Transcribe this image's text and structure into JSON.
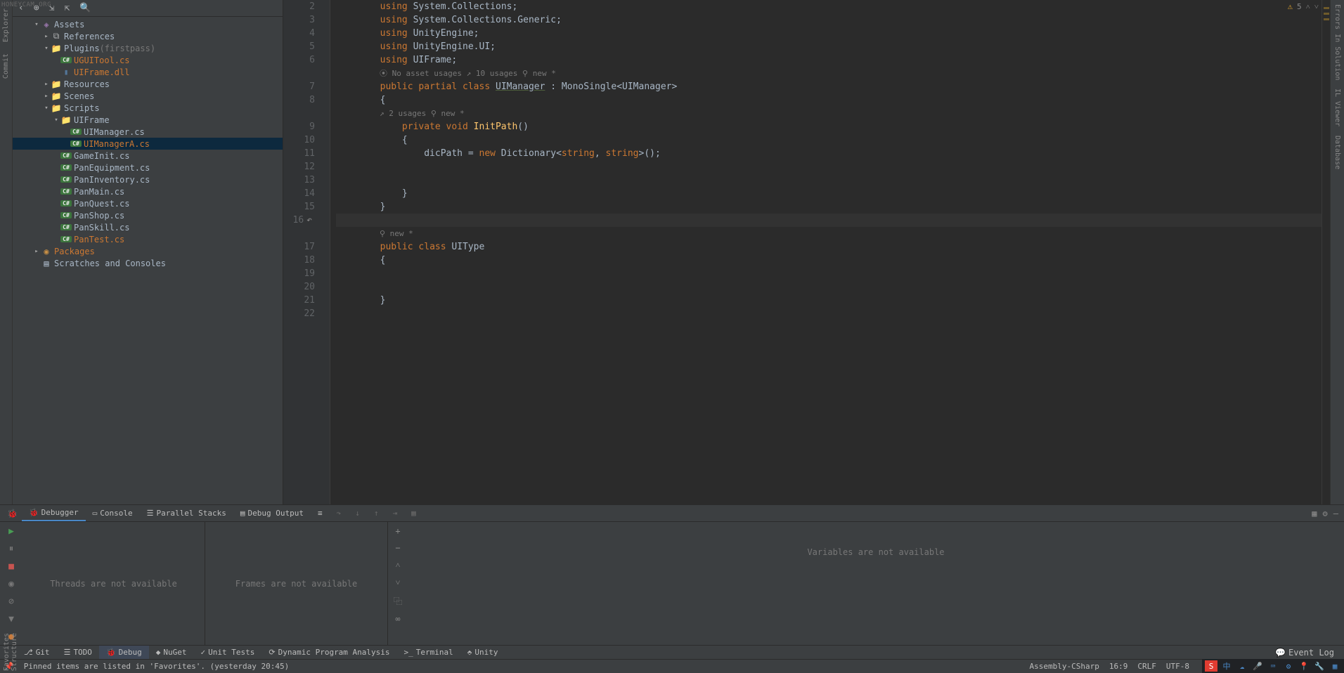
{
  "watermark": "HONEYCAM.ORG",
  "leftRail": {
    "explorer": "Explorer",
    "commit": "Commit"
  },
  "rightRail": {
    "errors": "Errors In Solution",
    "viewer": "IL Viewer",
    "database": "Database"
  },
  "explorer": {
    "tree": [
      {
        "indent": 2,
        "arrow": "▾",
        "icon": "assets",
        "label": "Assets",
        "highlighted": false
      },
      {
        "indent": 3,
        "arrow": "▸",
        "icon": "lib",
        "label": "References",
        "highlighted": false
      },
      {
        "indent": 3,
        "arrow": "▾",
        "icon": "folder",
        "label": "Plugins",
        "suffix": "(firstpass)",
        "highlighted": false
      },
      {
        "indent": 4,
        "arrow": "",
        "icon": "cs",
        "label": "UGUITool.cs",
        "highlighted": true
      },
      {
        "indent": 4,
        "arrow": "",
        "icon": "dll",
        "label": "UIFrame.dll",
        "highlighted": true
      },
      {
        "indent": 3,
        "arrow": "▸",
        "icon": "folder",
        "label": "Resources",
        "highlighted": false
      },
      {
        "indent": 3,
        "arrow": "▸",
        "icon": "folder",
        "label": "Scenes",
        "highlighted": false
      },
      {
        "indent": 3,
        "arrow": "▾",
        "icon": "folder",
        "label": "Scripts",
        "highlighted": false
      },
      {
        "indent": 4,
        "arrow": "▾",
        "icon": "folder",
        "label": "UIFrame",
        "highlighted": false
      },
      {
        "indent": 5,
        "arrow": "",
        "icon": "cs",
        "label": "UIManager.cs",
        "highlighted": false
      },
      {
        "indent": 5,
        "arrow": "",
        "icon": "cs",
        "label": "UIManagerA.cs",
        "highlighted": true,
        "selected": true
      },
      {
        "indent": 4,
        "arrow": "",
        "icon": "cs",
        "label": "GameInit.cs",
        "highlighted": false
      },
      {
        "indent": 4,
        "arrow": "",
        "icon": "cs",
        "label": "PanEquipment.cs",
        "highlighted": false
      },
      {
        "indent": 4,
        "arrow": "",
        "icon": "cs",
        "label": "PanInventory.cs",
        "highlighted": false
      },
      {
        "indent": 4,
        "arrow": "",
        "icon": "cs",
        "label": "PanMain.cs",
        "highlighted": false
      },
      {
        "indent": 4,
        "arrow": "",
        "icon": "cs",
        "label": "PanQuest.cs",
        "highlighted": false
      },
      {
        "indent": 4,
        "arrow": "",
        "icon": "cs",
        "label": "PanShop.cs",
        "highlighted": false
      },
      {
        "indent": 4,
        "arrow": "",
        "icon": "cs",
        "label": "PanSkill.cs",
        "highlighted": false
      },
      {
        "indent": 4,
        "arrow": "",
        "icon": "cs",
        "label": "PanTest.cs",
        "highlighted": true
      },
      {
        "indent": 2,
        "arrow": "▸",
        "icon": "packages",
        "label": "Packages",
        "highlighted": true
      },
      {
        "indent": 2,
        "arrow": "",
        "icon": "scratch",
        "label": "Scratches and Consoles",
        "highlighted": false
      }
    ]
  },
  "editor": {
    "warningCount": "5",
    "lines": [
      {
        "num": "2",
        "type": "code",
        "tokens": [
          {
            "t": "plain",
            "v": "        "
          },
          {
            "t": "kw",
            "v": "using"
          },
          {
            "t": "plain",
            "v": " System.Collections;"
          }
        ]
      },
      {
        "num": "3",
        "type": "code",
        "tokens": [
          {
            "t": "plain",
            "v": "        "
          },
          {
            "t": "kw",
            "v": "using"
          },
          {
            "t": "plain",
            "v": " System.Collections.Generic;"
          }
        ]
      },
      {
        "num": "4",
        "type": "code",
        "tokens": [
          {
            "t": "plain",
            "v": "        "
          },
          {
            "t": "kw",
            "v": "using"
          },
          {
            "t": "plain",
            "v": " UnityEngine;"
          }
        ]
      },
      {
        "num": "5",
        "type": "code",
        "tokens": [
          {
            "t": "plain",
            "v": "        "
          },
          {
            "t": "kw",
            "v": "using"
          },
          {
            "t": "plain",
            "v": " UnityEngine.UI;"
          }
        ]
      },
      {
        "num": "6",
        "type": "code",
        "tokens": [
          {
            "t": "plain",
            "v": "        "
          },
          {
            "t": "kw",
            "v": "using"
          },
          {
            "t": "plain",
            "v": " UIFrame;"
          }
        ]
      },
      {
        "num": "",
        "type": "hint",
        "text": "⦿ No asset usages   ↗ 10 usages   ⚲ new *"
      },
      {
        "num": "7",
        "type": "code",
        "tokens": [
          {
            "t": "plain",
            "v": "        "
          },
          {
            "t": "kw",
            "v": "public partial class"
          },
          {
            "t": "plain",
            "v": " "
          },
          {
            "t": "idu",
            "v": "UIManager"
          },
          {
            "t": "plain",
            "v": " : MonoSingle<UIManager>"
          }
        ]
      },
      {
        "num": "8",
        "type": "code",
        "tokens": [
          {
            "t": "plain",
            "v": "        {"
          }
        ]
      },
      {
        "num": "",
        "type": "hint",
        "text": "    ↗ 2 usages   ⚲ new *"
      },
      {
        "num": "9",
        "type": "code",
        "tokens": [
          {
            "t": "plain",
            "v": "            "
          },
          {
            "t": "kw",
            "v": "private void"
          },
          {
            "t": "plain",
            "v": " "
          },
          {
            "t": "method",
            "v": "InitPath"
          },
          {
            "t": "plain",
            "v": "()"
          }
        ]
      },
      {
        "num": "10",
        "type": "code",
        "tokens": [
          {
            "t": "plain",
            "v": "            {"
          }
        ]
      },
      {
        "num": "11",
        "type": "code",
        "tokens": [
          {
            "t": "plain",
            "v": "                dicPath = "
          },
          {
            "t": "kw",
            "v": "new"
          },
          {
            "t": "plain",
            "v": " Dictionary<"
          },
          {
            "t": "kw",
            "v": "string"
          },
          {
            "t": "plain",
            "v": ", "
          },
          {
            "t": "kw",
            "v": "string"
          },
          {
            "t": "plain",
            "v": ">();"
          }
        ]
      },
      {
        "num": "12",
        "type": "code",
        "tokens": [
          {
            "t": "plain",
            "v": " "
          }
        ]
      },
      {
        "num": "13",
        "type": "code",
        "tokens": [
          {
            "t": "plain",
            "v": " "
          }
        ]
      },
      {
        "num": "14",
        "type": "code",
        "tokens": [
          {
            "t": "plain",
            "v": "            }"
          }
        ]
      },
      {
        "num": "15",
        "type": "code",
        "tokens": [
          {
            "t": "plain",
            "v": "        }"
          }
        ]
      },
      {
        "num": "16",
        "type": "code",
        "cursor": true,
        "undo": true,
        "tokens": [
          {
            "t": "plain",
            "v": " "
          }
        ]
      },
      {
        "num": "",
        "type": "hint",
        "text": "⚲ new *"
      },
      {
        "num": "17",
        "type": "code",
        "tokens": [
          {
            "t": "plain",
            "v": "        "
          },
          {
            "t": "kw",
            "v": "public class"
          },
          {
            "t": "plain",
            "v": " UIType"
          }
        ]
      },
      {
        "num": "18",
        "type": "code",
        "tokens": [
          {
            "t": "plain",
            "v": "        {"
          }
        ]
      },
      {
        "num": "19",
        "type": "code",
        "tokens": [
          {
            "t": "plain",
            "v": " "
          }
        ]
      },
      {
        "num": "20",
        "type": "code",
        "tokens": [
          {
            "t": "plain",
            "v": " "
          }
        ]
      },
      {
        "num": "21",
        "type": "code",
        "tokens": [
          {
            "t": "plain",
            "v": "        }"
          }
        ]
      },
      {
        "num": "22",
        "type": "code",
        "tokens": [
          {
            "t": "plain",
            "v": " "
          }
        ]
      }
    ]
  },
  "debugPanel": {
    "tabs": [
      {
        "icon": "🐞",
        "label": "Debugger",
        "active": true
      },
      {
        "icon": "▭",
        "label": "Console"
      },
      {
        "icon": "☰",
        "label": "Parallel Stacks"
      },
      {
        "icon": "▤",
        "label": "Debug Output"
      }
    ],
    "threadsMsg": "Threads are not available",
    "framesMsg": "Frames are not available",
    "varsMsg": "Variables are not available"
  },
  "bottomTools": [
    {
      "icon": "⎇",
      "label": "Git"
    },
    {
      "icon": "☰",
      "label": "TODO"
    },
    {
      "icon": "🐞",
      "label": "Debug",
      "active": true
    },
    {
      "icon": "◆",
      "label": "NuGet"
    },
    {
      "icon": "✓",
      "label": "Unit Tests"
    },
    {
      "icon": "⟳",
      "label": "Dynamic Program Analysis"
    },
    {
      "icon": ">_",
      "label": "Terminal"
    },
    {
      "icon": "⬘",
      "label": "Unity"
    }
  ],
  "eventLog": "Event Log",
  "statusbar": {
    "message": "Pinned items are listed in 'Favorites'. (yesterday 20:45)",
    "project": "Assembly-CSharp",
    "position": "16:9",
    "lineEnding": "CRLF",
    "encoding": "UTF-8"
  }
}
